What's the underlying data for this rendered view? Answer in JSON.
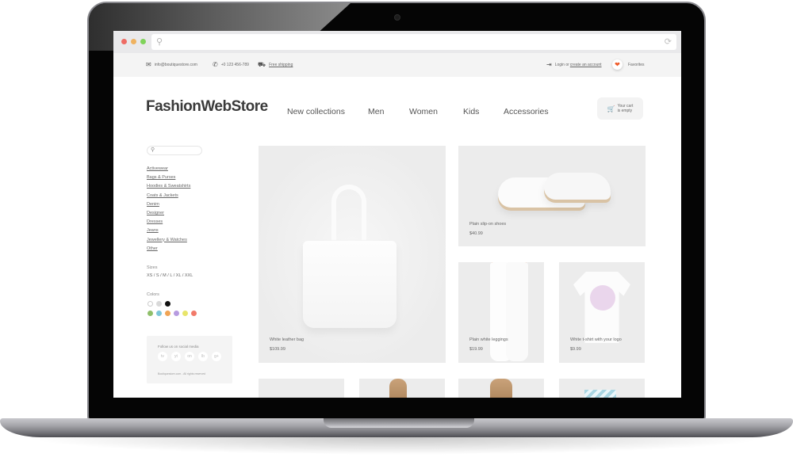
{
  "browser": {
    "url_placeholder": "",
    "search_icon": "search-icon",
    "reload_icon": "reload-icon"
  },
  "infobar": {
    "email": "info@boutiquestore.com",
    "phone": "+0 123 456-789",
    "shipping": "Free shipping",
    "login_prefix": "Login or ",
    "login_link": "create an account",
    "favorites": "Favorites"
  },
  "header": {
    "logo": "FashionWebStore",
    "nav": [
      "New collections",
      "Men",
      "Women",
      "Kids",
      "Accessories"
    ],
    "cart_line1": "Your cart",
    "cart_line2": "is empty"
  },
  "sidebar": {
    "search_placeholder": "",
    "categories": [
      "Activewear",
      "Bags & Purses",
      "Hoodies & Sweatshirts",
      "Coats & Jackets",
      "Denim",
      "Designer",
      "Dresses",
      "Jeans",
      "Jewellery & Watches",
      "Other"
    ],
    "sizes_label": "Sizes",
    "sizes": "XS / S / M / L / XL / XXL",
    "colors_label": "Colors",
    "colors_row1": [
      "#ffffff",
      "#d9d9d9",
      "#111111"
    ],
    "colors_row2": [
      "#8fbf6a",
      "#7ec6d9",
      "#f0a455",
      "#b79be0",
      "#e8e56a",
      "#f17a6a"
    ],
    "social_title": "Follow us on social media",
    "social_icons": [
      "tv",
      "yt",
      "on",
      "lb",
      "g+"
    ],
    "copyright": "Boutiquestore.com - All rights reserved"
  },
  "products": [
    {
      "name": "White leather bag",
      "price": "$109.99"
    },
    {
      "name": "Plain slip-on shoes",
      "price": "$40.99"
    },
    {
      "name": "Plain white leggings",
      "price": "$19.99"
    },
    {
      "name": "White t-shirt with your logo",
      "price": "$9.99"
    }
  ]
}
